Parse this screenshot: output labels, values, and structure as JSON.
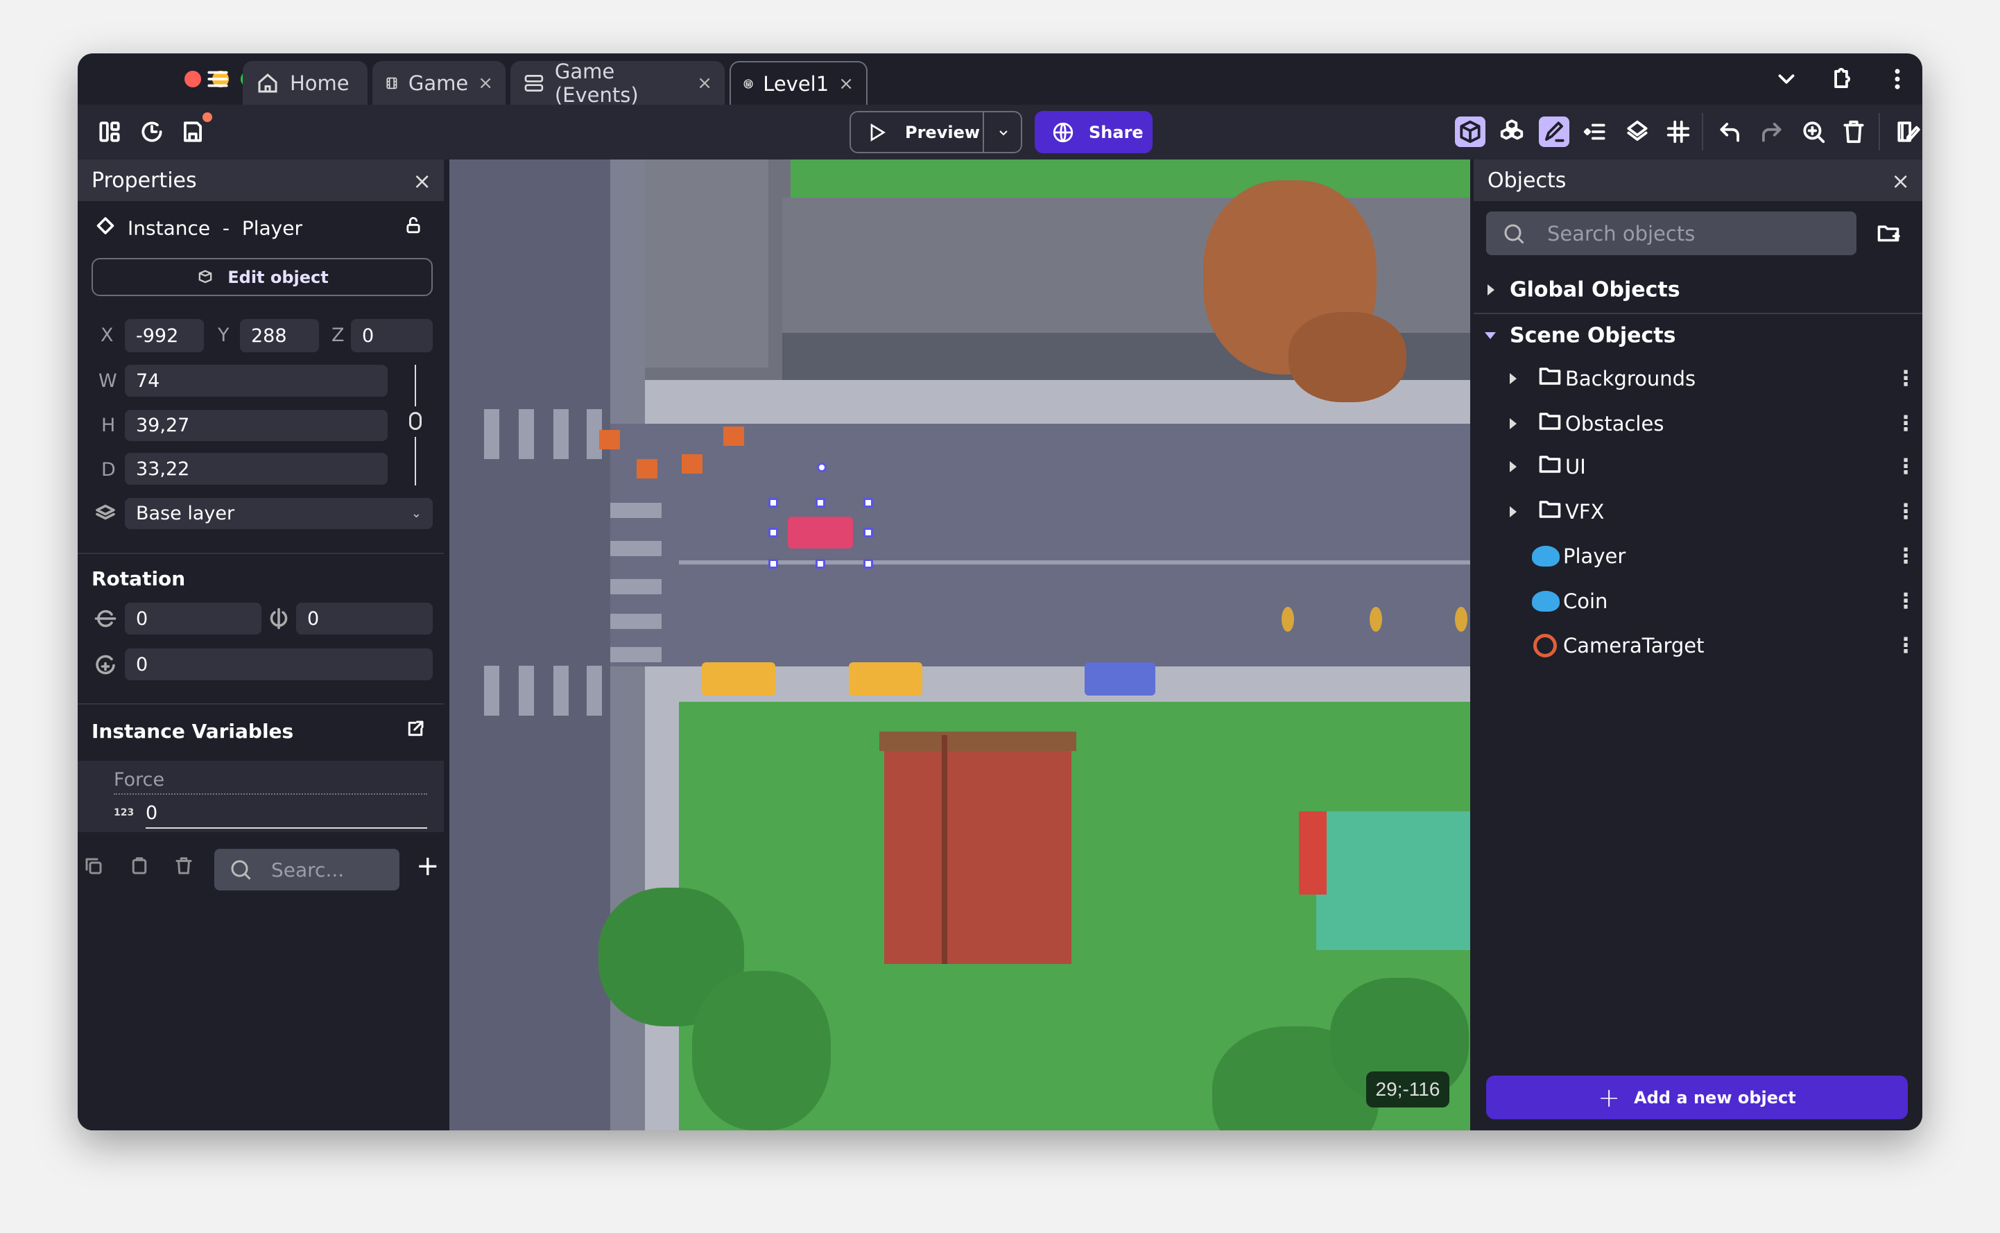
{
  "window": {
    "tabs": [
      {
        "label": "Home",
        "icon": "home-icon"
      },
      {
        "label": "Game",
        "icon": "film-icon",
        "closable": true
      },
      {
        "label": "Game (Events)",
        "icon": "events-icon",
        "closable": true
      },
      {
        "label": "Level1",
        "icon": "scene-icon",
        "closable": true,
        "active": true
      }
    ],
    "close_glyph": "×"
  },
  "toolbar": {
    "preview_label": "Preview",
    "share_label": "Share",
    "accent": "#4f2ad0",
    "active_tool_color": "#c6b8ff"
  },
  "properties": {
    "title": "Properties",
    "instance_label": "Instance",
    "separator": "-",
    "object_name": "Player",
    "edit_object_label": "Edit object",
    "x_label": "X",
    "x": "-992",
    "y_label": "Y",
    "y": "288",
    "z_label": "Z",
    "z": "0",
    "w_label": "W",
    "w": "74",
    "h_label": "H",
    "h": "39,27",
    "d_label": "D",
    "d": "33,22",
    "layer": "Base layer",
    "rotation_title": "Rotation",
    "rot_x": "0",
    "rot_y": "0",
    "rot_z": "0",
    "variables_title": "Instance Variables",
    "variable_name": "Force",
    "variable_type": "123",
    "variable_value": "0",
    "search_placeholder": "Searc..."
  },
  "canvas": {
    "coords": "29;-116"
  },
  "objects": {
    "title": "Objects",
    "search_placeholder": "Search objects",
    "global_label": "Global Objects",
    "scene_label": "Scene Objects",
    "folders": [
      "Backgrounds",
      "Obstacles",
      "UI",
      "VFX"
    ],
    "items": [
      {
        "label": "Player",
        "icon": "sprite-icon"
      },
      {
        "label": "Coin",
        "icon": "sprite-icon"
      },
      {
        "label": "CameraTarget",
        "icon": "target-icon"
      }
    ],
    "add_label": "Add a new object"
  }
}
